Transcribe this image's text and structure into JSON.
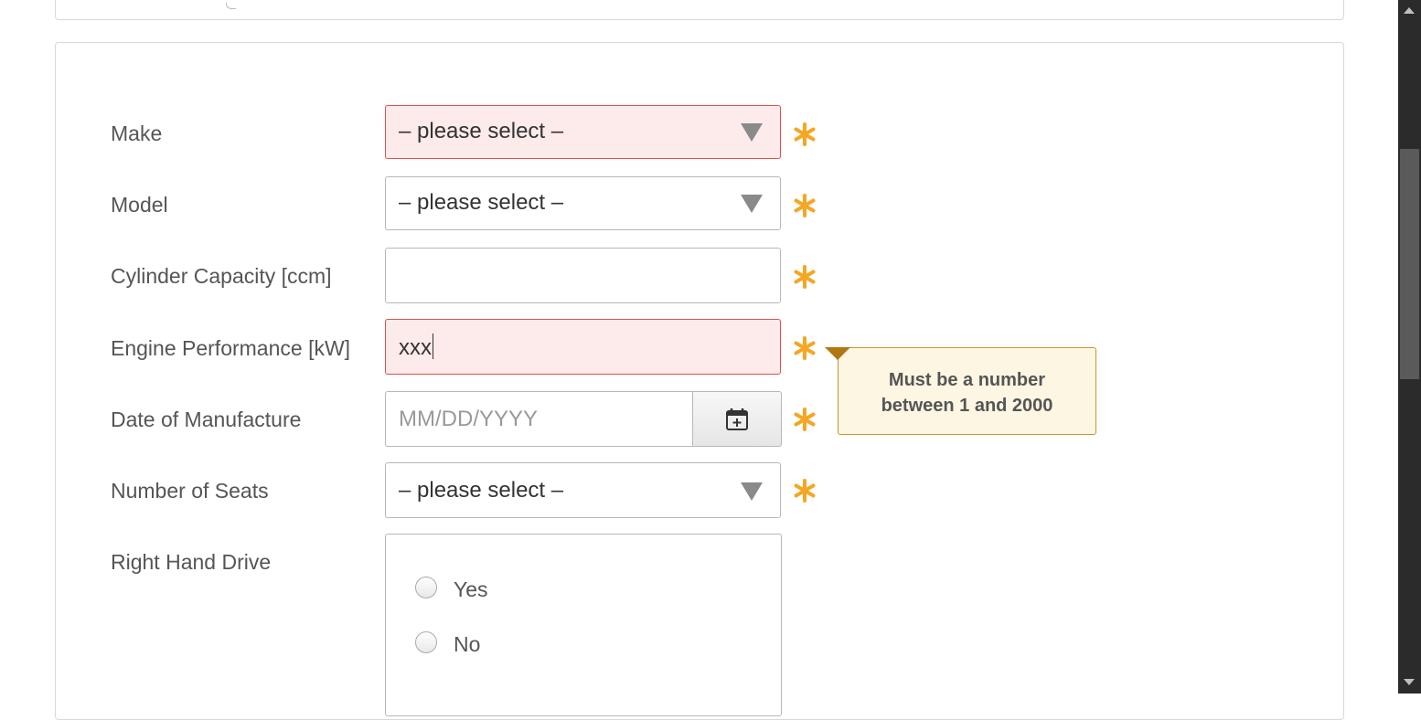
{
  "form": {
    "make": {
      "label": "Make",
      "value": "– please select –",
      "required": true,
      "state": "error"
    },
    "model": {
      "label": "Model",
      "value": "– please select –",
      "required": true
    },
    "cylinder_capacity": {
      "label": "Cylinder Capacity [ccm]",
      "value": "",
      "required": true
    },
    "engine_performance": {
      "label": "Engine Performance [kW]",
      "value": "xxx",
      "required": true,
      "state": "error"
    },
    "date_of_manufacture": {
      "label": "Date of Manufacture",
      "placeholder": "MM/DD/YYYY",
      "required": true,
      "button_icon": "calendar-plus-icon"
    },
    "number_of_seats": {
      "label": "Number of Seats",
      "value": "– please select –",
      "required": true
    },
    "right_hand_drive": {
      "label": "Right Hand Drive",
      "options": [
        "Yes",
        "No"
      ]
    }
  },
  "tooltip": {
    "line1": "Must be a number",
    "line2": "between 1 and 2000"
  },
  "colors": {
    "error_bg": "#fdeaea",
    "error_border": "#d9534f",
    "required_asterisk": "#f5a623",
    "tooltip_bg": "#fdf6e3",
    "tooltip_border": "#c8962e"
  }
}
